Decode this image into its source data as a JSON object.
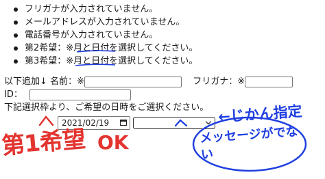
{
  "errors": [
    {
      "text": "フリガナが入力されていません。"
    },
    {
      "text": "メールアドレスが入力されていません。"
    },
    {
      "text": "電話番号が入力されていません。"
    },
    {
      "text": "第2希望：※月と日付を選択してください。"
    },
    {
      "text": "第3希望：※月と日付を選択してください。"
    }
  ],
  "form": {
    "prefix": "以下追加↓",
    "name_label": "名前：※",
    "furigana_label": "フリガナ：※",
    "id_label": "ID：",
    "date_instruction": "下記選択枠より、ご希望の日時をご選択ください。",
    "date_value": "2021/02/19"
  },
  "annotations": {
    "first_choice": "第1希望",
    "ok": "OK",
    "time_slot_note": "←じかん指定",
    "no_message": "メッセージがでない"
  },
  "colors": {
    "ink_red": "#e3342f",
    "ink_blue": "#1f3fe0"
  }
}
